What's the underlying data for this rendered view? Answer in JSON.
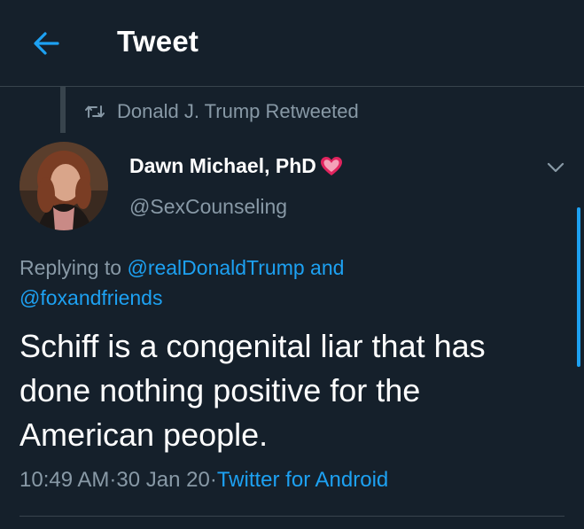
{
  "header": {
    "title": "Tweet"
  },
  "context": {
    "retweet_label": "Donald J. Trump Retweeted"
  },
  "author": {
    "display_name": "Dawn Michael, PhD",
    "handle": "@SexCounseling"
  },
  "reply": {
    "prefix": "Replying to ",
    "mention_1": "@realDonaldTrump",
    "connector": " and",
    "mention_2": "@foxandfriends"
  },
  "tweet": {
    "text": "Schiff is a congenital liar that has done nothing positive for the American people."
  },
  "meta": {
    "time": "10:49 AM",
    "separator_1": " · ",
    "date": "30 Jan 20",
    "separator_2": " · ",
    "source": "Twitter for Android"
  },
  "colors": {
    "background": "#15202b",
    "accent": "#1da1f2",
    "muted": "#8899a6",
    "heart": "#e0245e"
  },
  "icons": {
    "back": "back-arrow-icon",
    "retweet": "retweet-icon",
    "verified_heart": "heart-emoji-icon",
    "caret": "chevron-down-icon"
  }
}
